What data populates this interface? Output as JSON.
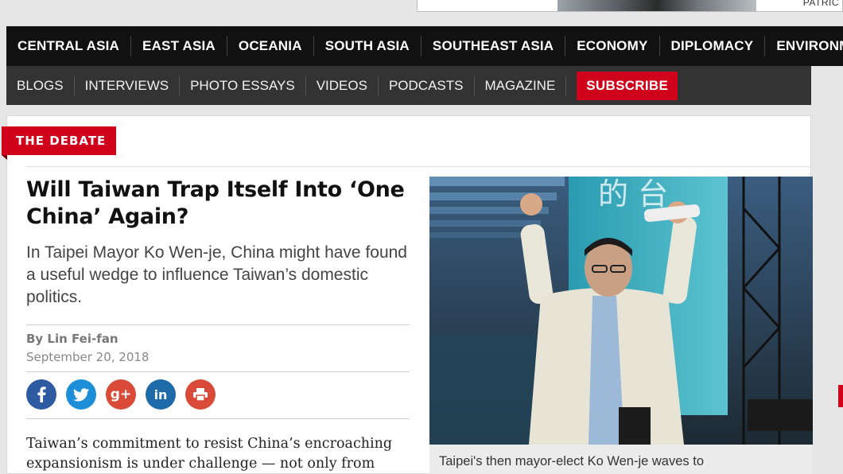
{
  "ad": {
    "text": "PATRIC"
  },
  "nav": {
    "primary": [
      "CENTRAL ASIA",
      "EAST ASIA",
      "OCEANIA",
      "SOUTH ASIA",
      "SOUTHEAST ASIA",
      "ECONOMY",
      "DIPLOMACY",
      "ENVIRONM"
    ],
    "secondary": [
      "BLOGS",
      "INTERVIEWS",
      "PHOTO ESSAYS",
      "VIDEOS",
      "PODCASTS",
      "MAGAZINE"
    ],
    "subscribe": "SUBSCRIBE"
  },
  "article": {
    "section_tag": "THE DEBATE",
    "title": "Will Taiwan Trap Itself Into ‘One China’ Again?",
    "dek": "In Taipei Mayor Ko Wen-je, China might have found a useful wedge to influence Taiwan’s domestic politics.",
    "byline": "By Lin Fei-fan",
    "date": "September 20, 2018",
    "body_line1": "Taiwan’s commitment to resist China’s encroaching",
    "body_line2": "expansionism is under challenge — not only from",
    "photo_caption": "Taipei's then mayor-elect Ko Wen-je waves to",
    "photo_sign_text": "的 台"
  },
  "share": [
    {
      "icon": "facebook-icon",
      "glyph": "f",
      "color": "#2d5aa0"
    },
    {
      "icon": "twitter-icon",
      "glyph": "t",
      "color": "#1d8fd8"
    },
    {
      "icon": "google-plus-icon",
      "glyph": "g+",
      "color": "#d94a38"
    },
    {
      "icon": "linkedin-icon",
      "glyph": "in",
      "color": "#1f6aa8"
    },
    {
      "icon": "print-icon",
      "glyph": "⎙",
      "color": "#d94a38"
    }
  ],
  "colors": {
    "brand_red": "#d0021b",
    "nav_dark": "#111111",
    "nav_secondary": "#333333"
  }
}
